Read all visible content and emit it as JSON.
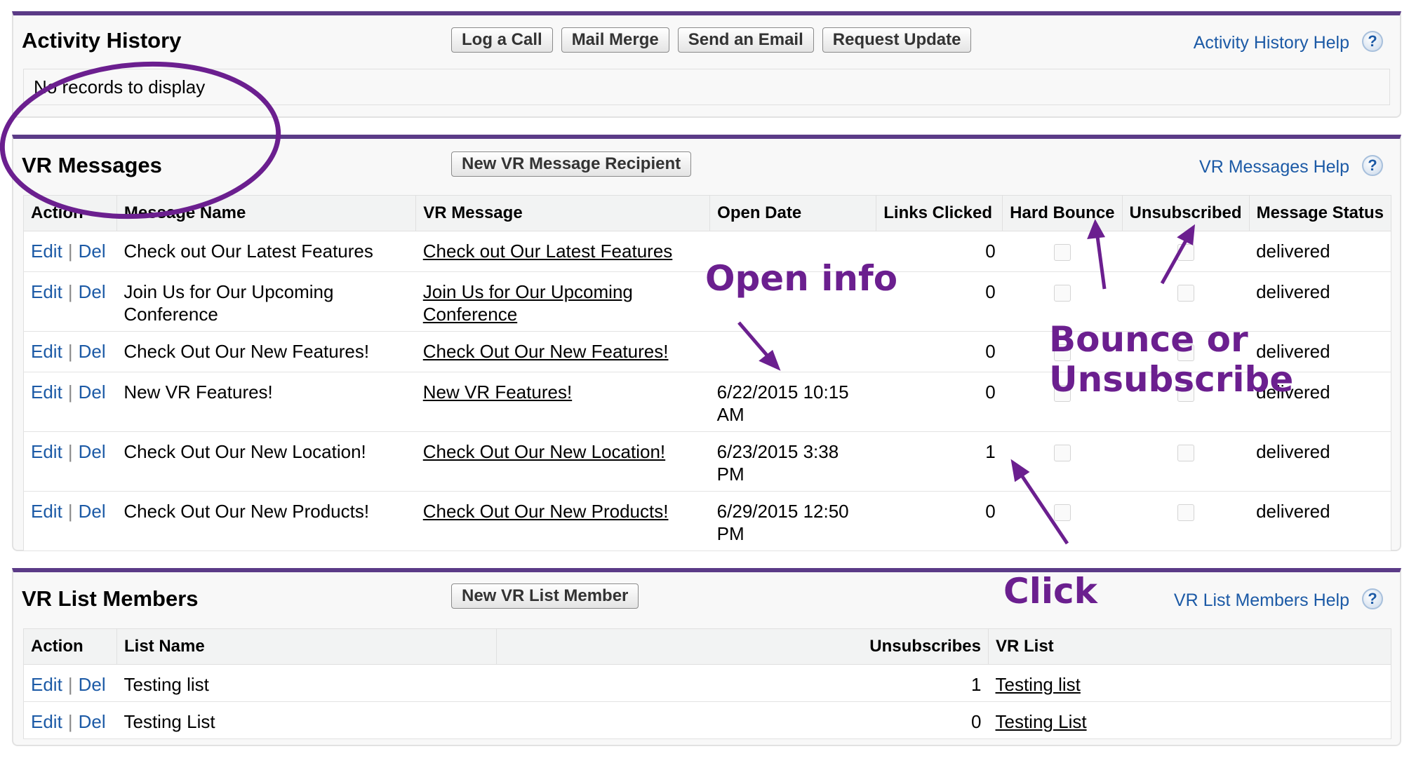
{
  "activity": {
    "title": "Activity History",
    "buttons": [
      "Log a Call",
      "Mail Merge",
      "Send an Email",
      "Request Update"
    ],
    "help": "Activity History Help",
    "empty": "No records to display"
  },
  "vr": {
    "title": "VR Messages",
    "button": "New VR Message Recipient",
    "help": "VR Messages Help",
    "columns": [
      "Action",
      "Message Name",
      "VR Message",
      "Open Date",
      "Links Clicked",
      "Hard Bounce",
      "Unsubscribed",
      "Message Status"
    ],
    "action_edit": "Edit",
    "action_sep": "|",
    "action_del": "Del",
    "rows": [
      {
        "name": "Check out Our Latest Features",
        "message": "Check out Our Latest Features",
        "open_date": "",
        "links": "0",
        "hard_bounce": false,
        "unsubscribed": false,
        "status": "delivered"
      },
      {
        "name": "Join Us for Our Upcoming Conference",
        "message": "Join Us for Our Upcoming Conference",
        "open_date": "",
        "links": "0",
        "hard_bounce": false,
        "unsubscribed": false,
        "status": "delivered"
      },
      {
        "name": "Check Out Our New Features!",
        "message": "Check Out Our New Features!",
        "open_date": "",
        "links": "0",
        "hard_bounce": false,
        "unsubscribed": false,
        "status": "delivered"
      },
      {
        "name": "New VR Features!",
        "message": "New VR Features!",
        "open_date": "6/22/2015 10:15 AM",
        "links": "0",
        "hard_bounce": false,
        "unsubscribed": false,
        "status": "delivered"
      },
      {
        "name": "Check Out Our New Location!",
        "message": "Check Out Our New Location!",
        "open_date": "6/23/2015 3:38 PM",
        "links": "1",
        "hard_bounce": false,
        "unsubscribed": false,
        "status": "delivered"
      },
      {
        "name": "Check Out Our New Products!",
        "message": "Check Out Our New Products!",
        "open_date": "6/29/2015 12:50 PM",
        "links": "0",
        "hard_bounce": false,
        "unsubscribed": false,
        "status": "delivered"
      }
    ]
  },
  "list": {
    "title": "VR List Members",
    "button": "New VR List Member",
    "help": "VR List Members Help",
    "columns": [
      "Action",
      "List Name",
      "Unsubscribes",
      "VR List"
    ],
    "rows": [
      {
        "name": "Testing list",
        "unsubscribes": "1",
        "vr_list": "Testing list"
      },
      {
        "name": "Testing List",
        "unsubscribes": "0",
        "vr_list": "Testing List"
      }
    ]
  },
  "annotations": {
    "open_info": "Open info",
    "bounce_line1": "Bounce or",
    "bounce_line2": "Unsubscribe",
    "click": "Click",
    "color": "#6b1f8f"
  },
  "theme": {
    "panel_border": "#5b3b87",
    "link_blue": "#1c5aa6"
  }
}
